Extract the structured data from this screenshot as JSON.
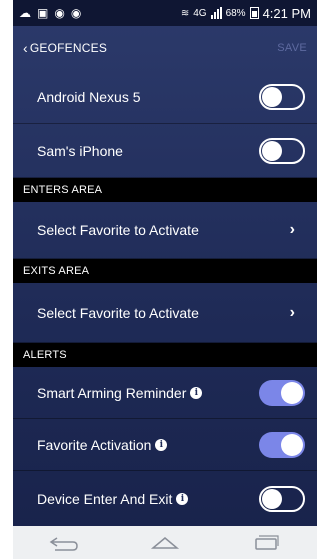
{
  "status_bar": {
    "network": "4G",
    "battery": "68%",
    "time": "4:21 PM"
  },
  "header": {
    "back_label": "GEOFENCES",
    "save_label": "SAVE"
  },
  "devices": [
    {
      "label": "Android Nexus 5",
      "toggle": "off"
    },
    {
      "label": "Sam's iPhone",
      "toggle": "off"
    }
  ],
  "enters_area": {
    "header": "ENTERS AREA",
    "select_label": "Select Favorite to Activate"
  },
  "exits_area": {
    "header": "EXITS AREA",
    "select_label": "Select Favorite to Activate"
  },
  "alerts": {
    "header": "ALERTS",
    "items": [
      {
        "label": "Smart Arming Reminder",
        "toggle": "on"
      },
      {
        "label": "Favorite Activation",
        "toggle": "on"
      },
      {
        "label": "Device Enter And Exit",
        "toggle": "off"
      }
    ]
  },
  "colors": {
    "background": "#1f2b57",
    "toggle_on": "#7b86e8",
    "section_header": "#000000"
  }
}
